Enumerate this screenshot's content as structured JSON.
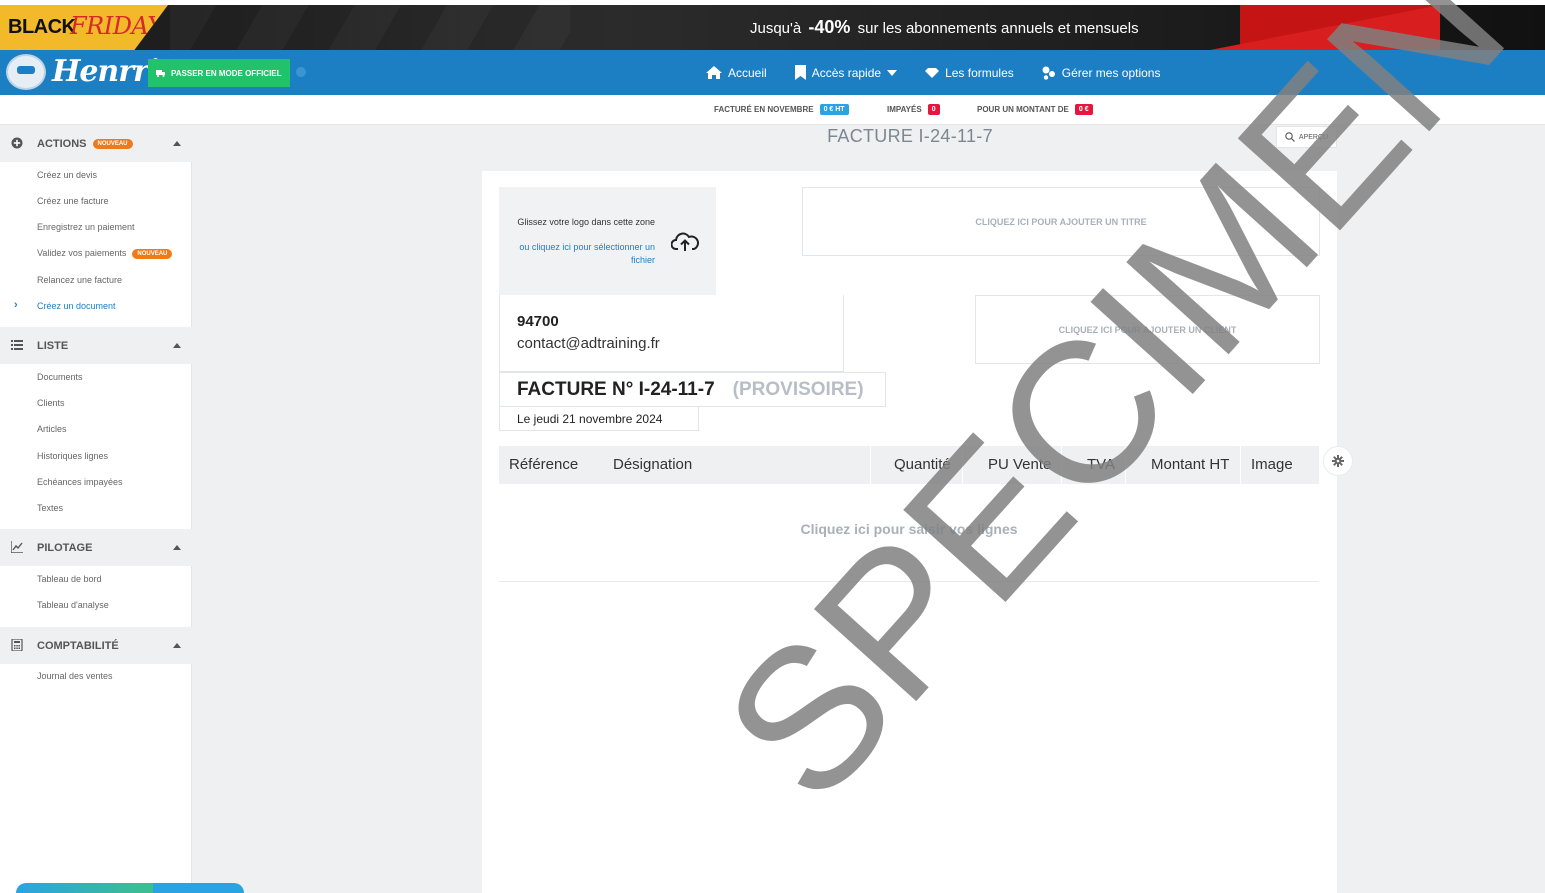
{
  "promo": {
    "logo_black": "BLACK",
    "logo_friday": "FRIDAY",
    "text_prefix": "Jusqu'à",
    "text_discount": "-40%",
    "text_suffix": "sur les abonnements annuels et mensuels"
  },
  "header": {
    "brand": "Henrri",
    "official_mode_button": "PASSER EN MODE OFFICIEL",
    "nav": [
      {
        "label": "Accueil",
        "icon": "home-icon"
      },
      {
        "label": "Accès rapide",
        "icon": "bookmark-icon"
      },
      {
        "label": "Les formules",
        "icon": "diamond-icon"
      },
      {
        "label": "Gérer mes options",
        "icon": "options-icon"
      }
    ]
  },
  "stats": {
    "billed_label": "FACTURÉ EN NOVEMBRE",
    "billed_value": "0 € HT",
    "unpaid_label": "IMPAYÉS",
    "unpaid_value": "0",
    "amount_label": "POUR UN MONTANT DE",
    "amount_value": "0 €",
    "colors": {
      "billed": "#2aa3e5",
      "unpaid": "#e5173f",
      "amount": "#e5173f"
    }
  },
  "sidebar": {
    "new_badge": "NOUVEAU",
    "sections": [
      {
        "title": "ACTIONS",
        "badge": true,
        "items": [
          {
            "label": "Créez un devis"
          },
          {
            "label": "Créez une facture"
          },
          {
            "label": "Enregistrez un paiement"
          },
          {
            "label": "Validez vos paiements",
            "badge": true
          },
          {
            "label": "Relancez une facture"
          },
          {
            "label": "Créez un document",
            "active": true
          }
        ]
      },
      {
        "title": "LISTE",
        "items": [
          {
            "label": "Documents"
          },
          {
            "label": "Clients"
          },
          {
            "label": "Articles"
          },
          {
            "label": "Historiques lignes"
          },
          {
            "label": "Echéances impayées"
          },
          {
            "label": "Textes"
          }
        ]
      },
      {
        "title": "PILOTAGE",
        "items": [
          {
            "label": "Tableau de bord"
          },
          {
            "label": "Tableau d'analyse"
          }
        ]
      },
      {
        "title": "COMPTABILITÉ",
        "items": [
          {
            "label": "Journal des ventes"
          }
        ]
      }
    ]
  },
  "document": {
    "page_title": "FACTURE I-24-11-7",
    "preview_button": "APERÇU",
    "logo_drop_text": "Glissez votre logo dans cette zone",
    "logo_drop_link": "ou cliquez ici pour sélectionner un fichier",
    "title_placeholder": "CLIQUEZ ICI POUR AJOUTER UN TITRE",
    "sender_zip": "94700",
    "sender_email": "contact@adtraining.fr",
    "client_placeholder": "CLIQUEZ ICI POUR AJOUTER UN CLIENT",
    "invoice_number": "FACTURE N° I-24-11-7",
    "invoice_status": "(PROVISOIRE)",
    "invoice_date": "Le jeudi 21 novembre 2024",
    "columns": [
      "Référence",
      "Désignation",
      "Quantité",
      "PU Vente",
      "TVA",
      "Montant HT",
      "Image"
    ],
    "lines_placeholder": "Cliquez ici pour saisir vos lignes",
    "watermark": "SPECIMEN"
  }
}
